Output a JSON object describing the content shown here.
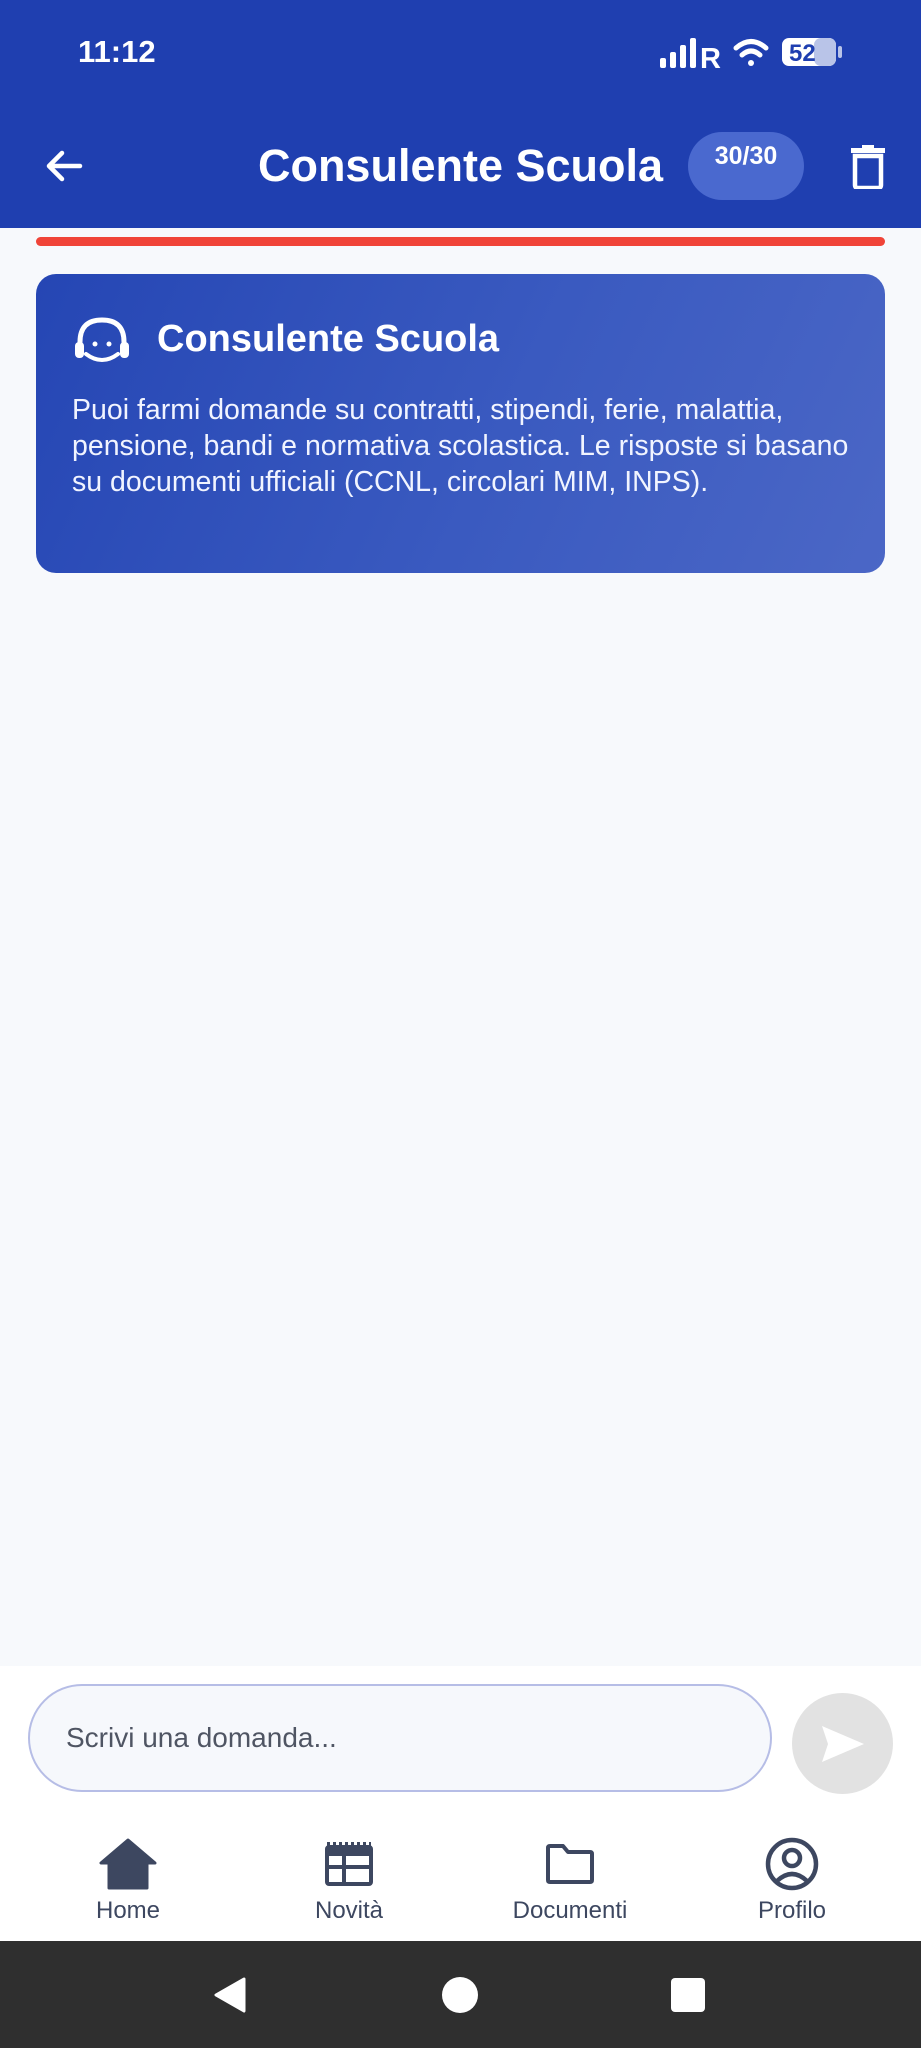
{
  "status_bar": {
    "time": "11:12",
    "network": "R",
    "battery": "52"
  },
  "header": {
    "title": "Consulente Scuola",
    "counter": "30/30",
    "back_icon": "arrow-left-icon",
    "delete_icon": "trash-icon"
  },
  "progress": {
    "fraction": 1.0,
    "color": "#f04438"
  },
  "info_card": {
    "icon": "headset-icon",
    "title": "Consulente Scuola",
    "description": "Puoi farmi domande su contratti, stipendi, ferie, malattia, pensione, bandi e normativa scolastica. Le risposte si basano su documenti ufficiali (CCNL, circolari MIM, INPS)."
  },
  "composer": {
    "placeholder": "Scrivi una domanda...",
    "value": "",
    "send_icon": "send-icon"
  },
  "bottom_nav": {
    "items": [
      {
        "label": "Home",
        "icon": "home-icon",
        "active": true
      },
      {
        "label": "Novità",
        "icon": "news-icon",
        "active": false
      },
      {
        "label": "Documenti",
        "icon": "folder-icon",
        "active": false
      },
      {
        "label": "Profilo",
        "icon": "profile-icon",
        "active": false
      }
    ]
  },
  "colors": {
    "primary": "#1f3fb0",
    "counter_bg": "#4a69cf",
    "background": "#f7f9fc",
    "nav_text": "#3d4760"
  }
}
